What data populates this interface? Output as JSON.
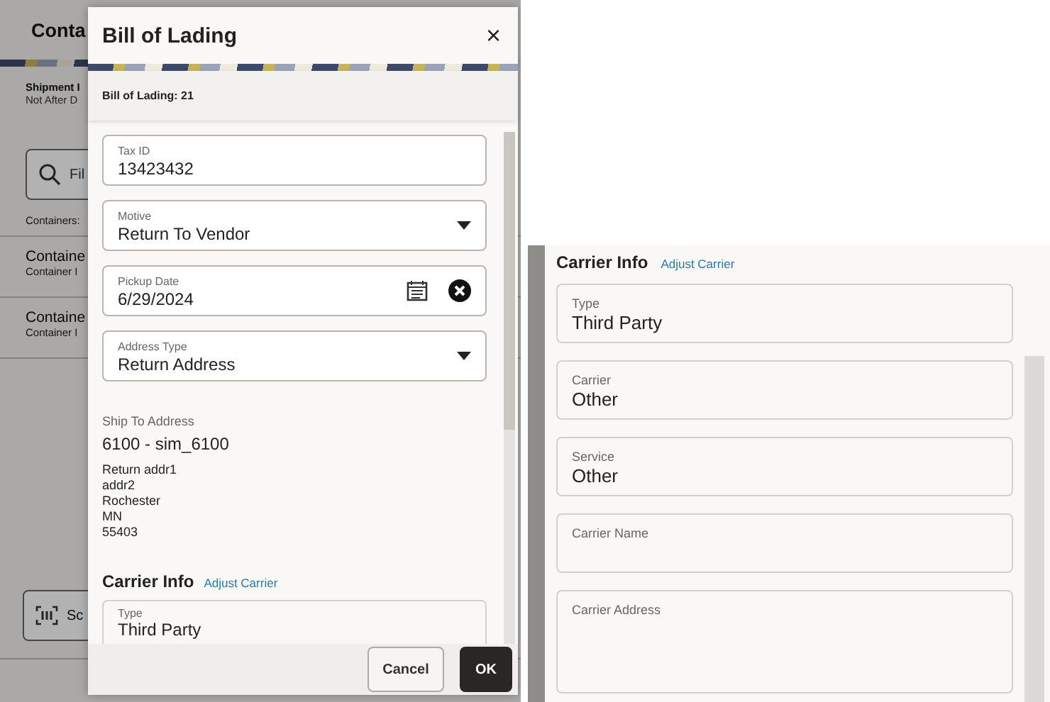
{
  "background_page": {
    "title": "Conta",
    "shipment_label": "Shipment I",
    "shipment_sub": "Not After D",
    "search_placeholder": "Fil",
    "containers_label": "Containers:",
    "rows": [
      {
        "title": "Containe",
        "subtitle": "Container I"
      },
      {
        "title": "Containe",
        "subtitle": "Container I"
      }
    ],
    "scan_button": "Sc"
  },
  "dialog": {
    "title": "Bill of Lading",
    "close": "×",
    "subtitle": "Bill of Lading: 21",
    "fields": [
      {
        "kind": "text",
        "label": "Tax ID",
        "value": "13423432"
      },
      {
        "kind": "select",
        "label": "Motive",
        "value": "Return To Vendor"
      },
      {
        "kind": "date",
        "label": "Pickup Date",
        "value": "6/29/2024"
      },
      {
        "kind": "select",
        "label": "Address Type",
        "value": "Return Address"
      }
    ],
    "ship_to": {
      "label": "Ship To Address",
      "name": "6100 - sim_6100",
      "lines": [
        "Return addr1",
        "addr2",
        "Rochester",
        "MN",
        "55403"
      ]
    },
    "carrier": {
      "title": "Carrier Info",
      "link": "Adjust Carrier",
      "fields": [
        {
          "kind": "text",
          "label": "Type",
          "value": "Third Party"
        }
      ]
    },
    "buttons": [
      {
        "kind": "secondary",
        "label": "Cancel"
      },
      {
        "kind": "primary",
        "label": "OK"
      }
    ]
  },
  "detail_panel": {
    "carrier": {
      "title": "Carrier Info",
      "link": "Adjust Carrier",
      "fields": [
        {
          "kind": "text",
          "label": "Type",
          "value": "Third Party"
        },
        {
          "kind": "text",
          "label": "Carrier",
          "value": "Other"
        },
        {
          "kind": "text",
          "label": "Service",
          "value": "Other"
        },
        {
          "kind": "text",
          "label": "Carrier Name"
        },
        {
          "kind": "textarea",
          "label": "Carrier Address"
        }
      ]
    }
  }
}
